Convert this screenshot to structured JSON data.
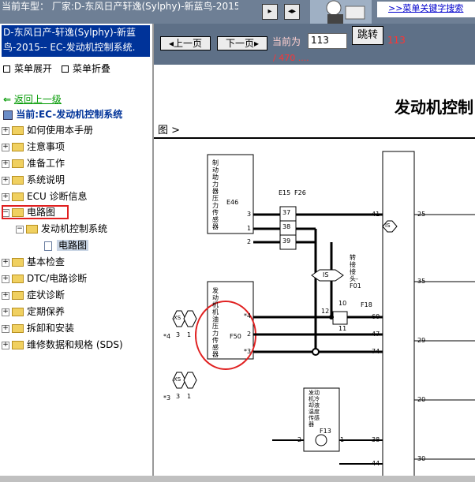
{
  "header": {
    "car_type_label": "当前车型：",
    "car_type_value": "厂家:D-东风日产轩逸(Sylphy)-新蓝鸟-2015-",
    "keyword_search_link": ">>菜单关键字搜索"
  },
  "sidebar": {
    "system_title": "D-东风日产-轩逸(Sylphy)-新蓝鸟-2015-- EC-发动机控制系统.",
    "expand_menu": "菜单展开",
    "collapse_menu": "菜单折叠",
    "back_link": "返回上一级",
    "current": "当前:EC-发动机控制系统",
    "tree": [
      {
        "label": "如何使用本手册"
      },
      {
        "label": "注意事项"
      },
      {
        "label": "准备工作"
      },
      {
        "label": "系统说明"
      },
      {
        "label": "ECU 诊断信息"
      },
      {
        "label": "电路图"
      },
      {
        "label": "发动机控制系统"
      },
      {
        "label": "电路图"
      },
      {
        "label": "基本检查"
      },
      {
        "label": "DTC/电路诊断"
      },
      {
        "label": "症状诊断"
      },
      {
        "label": "定期保养"
      },
      {
        "label": "拆卸和安装"
      },
      {
        "label": "维修数据和规格 (SDS)"
      }
    ]
  },
  "pager": {
    "prev_label": "上一页",
    "next_label": "下一页",
    "current_label": "当前为",
    "page_value": "113",
    "jump_label": "跳转",
    "page_number": "113",
    "total": "/ 470 ...."
  },
  "document": {
    "title": "发动机控制",
    "subtitle": "图 >",
    "labels": {
      "sensor1": "制动助力器压力传感器",
      "sensor1_code": "E46",
      "sensor2": "发动机机油压力传感器",
      "sensor2_code": "F50",
      "sensor3": "发动机冷却液温度传感器",
      "sensor3_code": "F13",
      "joint": "转接接头-F01",
      "joint_code": "F18",
      "is": "IS",
      "xs": "XS",
      "e15": "E15",
      "f26": "F26",
      "pins_left": [
        "3",
        "1",
        "2",
        "*4",
        "2",
        "*3",
        "2",
        "1"
      ],
      "pins_mid": [
        "37",
        "38",
        "39",
        "12",
        "10",
        "11"
      ],
      "pins_right": [
        "41",
        "60",
        "47",
        "74",
        "38",
        "44"
      ],
      "pins_far": [
        "25",
        "35",
        "29",
        "20",
        "30"
      ],
      "xs_pins": [
        "3",
        "1",
        "3",
        "1",
        "*4",
        "*3"
      ]
    }
  }
}
